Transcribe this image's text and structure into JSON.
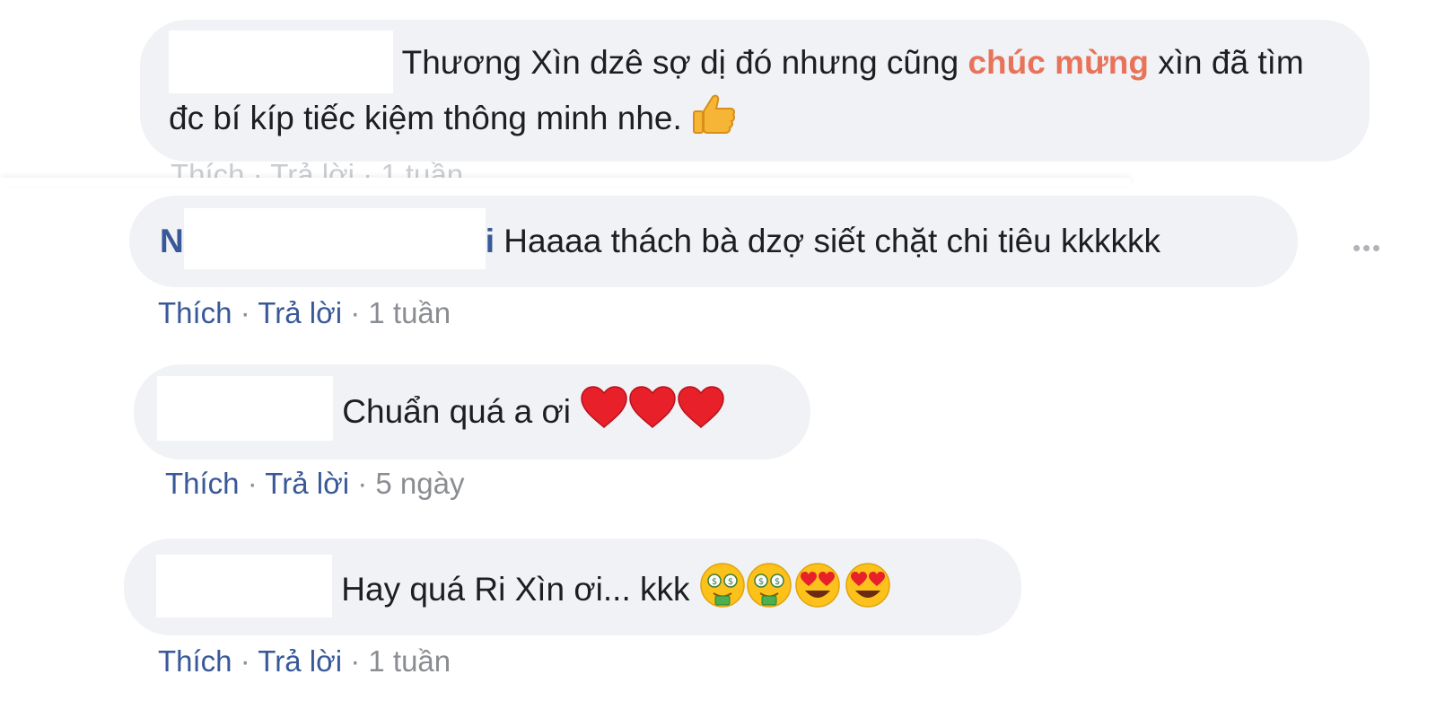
{
  "comments": [
    {
      "text_part1": "Thương Xìn dzê sợ dị đó nhưng cũng ",
      "highlight": "chúc mừng",
      "text_part2": " xìn đã tìm đc bí kíp tiếc kiệm thông minh nhe.",
      "emojis": [
        "thumbs-up"
      ]
    },
    {
      "name_prefix": "N",
      "name_suffix": "i",
      "text": "Haaaa thách bà dzợ siết chặt chi tiêu kkkkkk",
      "like": "Thích",
      "reply": "Trả lời",
      "time": "1 tuần",
      "sep": "·"
    },
    {
      "text": "Chuẩn quá a ơi",
      "emojis": [
        "heart",
        "heart",
        "heart"
      ],
      "like": "Thích",
      "reply": "Trả lời",
      "time": "5 ngày",
      "sep": "·"
    },
    {
      "text": "Hay quá Ri Xìn ơi... kkk",
      "emojis": [
        "money-mouth-face",
        "money-mouth-face",
        "heart-eyes-face",
        "heart-eyes-face"
      ],
      "like": "Thích",
      "reply": "Trả lời",
      "time": "1 tuần",
      "sep": "·"
    }
  ],
  "more_options_icon": "more-horizontal-icon",
  "colors": {
    "bubble": "#f0f2f5",
    "link": "#385898",
    "meta": "#8a8d91",
    "highlight": "#e8735a"
  }
}
